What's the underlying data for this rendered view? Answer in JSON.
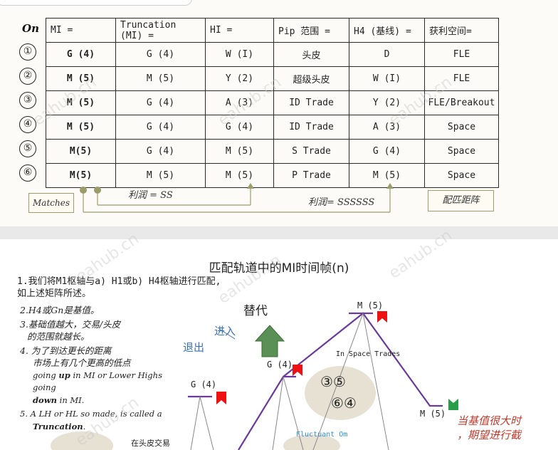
{
  "matrix": {
    "on_label": "On",
    "headers": [
      "MI =",
      "Truncation (MI) =",
      "HI =",
      "Pip 范围 =",
      "H4 (基线) =",
      "获利空间="
    ],
    "row_numbers": [
      "①",
      "②",
      "③",
      "④",
      "⑤",
      "⑥"
    ],
    "rows": [
      [
        "G (4)",
        "G (4)",
        "W (I)",
        "头皮",
        "D",
        "FLE"
      ],
      [
        "M (5)",
        "M (5)",
        "Y (2)",
        "超级头皮",
        "W (I)",
        "FLE"
      ],
      [
        "M (5)",
        "G (4)",
        "A (3)",
        "ID Trade",
        "Y (2)",
        "FLE/Breakout"
      ],
      [
        "M (5)",
        "G (4)",
        "G (4)",
        "ID Trade",
        "A (3)",
        "Space"
      ],
      [
        "M(5)",
        "G (4)",
        "M (5)",
        "S Trade",
        "G (4)",
        "Space"
      ],
      [
        "M(5)",
        "M (5)",
        "M (5)",
        "P Trade",
        "M (5)",
        "Space"
      ]
    ],
    "colors": {
      "gold": "#d4a800",
      "purple": "#6a3b9c",
      "blue": "#3b74b3",
      "dark": "#222222"
    }
  },
  "annotations": {
    "matches": "Matches",
    "profit_ss": "利润 = SS",
    "profit_ssssss": "利润= SSSSSS",
    "match_matrix": "配匹距阵"
  },
  "slide2": {
    "title": "匹配轨道中的MI时间帧(n)",
    "line1a": "1.我们将M1枢轴与a) H1或b) H4枢轴进行匹配,",
    "line1b": "如上述矩阵所述。",
    "items": {
      "i2": "2.H4或Gn是基值。",
      "i3a": "3.基础值越大，交易/头皮",
      "i3b": "的范围就越长。",
      "i4a": "4. 为了到达更长的距离",
      "i4b": "市场上有几个更高的低点",
      "i4c_pre": "going ",
      "i4c_b1": "up",
      "i4c_mid": " in MI or Lower Highs going",
      "i4d_b": "down",
      "i4d_post": " in MI.",
      "i5a": "5. A LH or HL so made, is called a",
      "i5b": "Truncation",
      "i5b_post": "."
    },
    "diagram": {
      "replace": "替代",
      "enter": "进入",
      "exit": "退出",
      "peak_label": "M (5)",
      "g4_mid": "G (4)",
      "g4_left": "G (4)",
      "m5_right": "M (5)",
      "in_space": "In Space Trades",
      "fluctuant": "Fluctuant Om",
      "bottom_cut": "在头皮交易",
      "nums_top": [
        "③",
        "⑤"
      ],
      "nums_bot": [
        "⑥",
        "④"
      ],
      "red_note_1": "当基值很大时",
      "red_note_2": "，期望进行截"
    }
  },
  "watermarks": [
    "eahub.cn",
    "eahub.cn",
    "eahub.cn",
    "eahub.cn",
    "eahub.cn",
    "eahub.cn",
    "eahub.cn"
  ]
}
